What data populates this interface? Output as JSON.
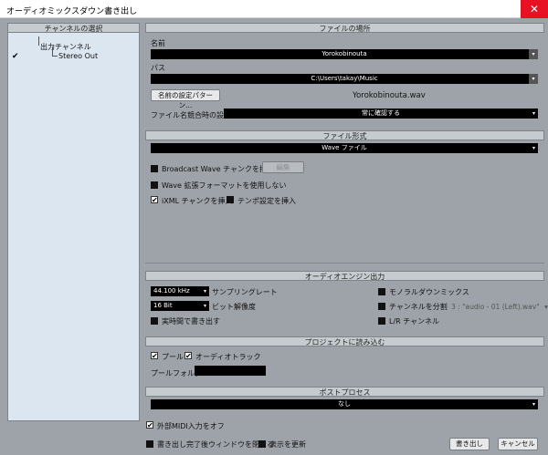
{
  "window": {
    "title": "オーディオミックスダウン書き出し",
    "close_glyph": "✕"
  },
  "channel_panel": {
    "header": "チャンネルの選択",
    "tree_parent": "出力チャンネル",
    "tree_child": "Stereo Out",
    "child_checked": true
  },
  "file_location": {
    "header": "ファイルの場所",
    "name_label": "名前",
    "name_value": "Yorokobinouta",
    "path_label": "パス",
    "path_value": "C:\\Users\\takay\\Music",
    "naming_button": "名前の設定パターン...",
    "filename_preview": "Yorokobinouta.wav",
    "conflict_label": "ファイル名競合時の設定",
    "conflict_value": "常に確認する"
  },
  "file_format": {
    "header": "ファイル形式",
    "format_value": "Wave ファイル",
    "bwf_label": "Broadcast Wave チャンクを挿入",
    "bwf_checked": false,
    "edit_button": "編集",
    "ext_label": "Wave 拡張フォーマットを使用しない",
    "ext_checked": false,
    "ixml_label": "iXML チャンクを挿入",
    "ixml_checked": true,
    "tempo_label": "テンポ設定を挿入",
    "tempo_checked": false
  },
  "audio_engine": {
    "header": "オーディオエンジン出力",
    "sample_rate_value": "44.100 kHz",
    "sample_rate_label": "サンプリングレート",
    "bit_value": "16 Bit",
    "bit_label": "ビット解像度",
    "realtime_label": "実時間で書き出す",
    "realtime_checked": false,
    "mono_label": "モノラルダウンミックス",
    "mono_checked": false,
    "split_label": "チャンネルを分割",
    "split_checked": false,
    "split_value": "3 : \"audio - 01 (Left).wav\"",
    "lr_label": "L/R チャンネル",
    "lr_checked": false
  },
  "import_project": {
    "header": "プロジェクトに読み込む",
    "pool_label": "プール",
    "pool_checked": true,
    "track_label": "オーディオトラック",
    "track_checked": true,
    "folder_label": "プールフォルダー",
    "folder_value": ""
  },
  "post_process": {
    "header": "ポストプロセス",
    "value": "なし"
  },
  "footer": {
    "midi_label": "外部MIDI入力をオフ",
    "midi_checked": true,
    "close_window_label": "書き出し完了後ウィンドウを閉じる",
    "close_window_checked": false,
    "update_label": "表示を更新",
    "update_checked": false,
    "export_button": "書き出し",
    "cancel_button": "キャンセル"
  },
  "glyphs": {
    "check": "✔",
    "caret": "▾"
  }
}
